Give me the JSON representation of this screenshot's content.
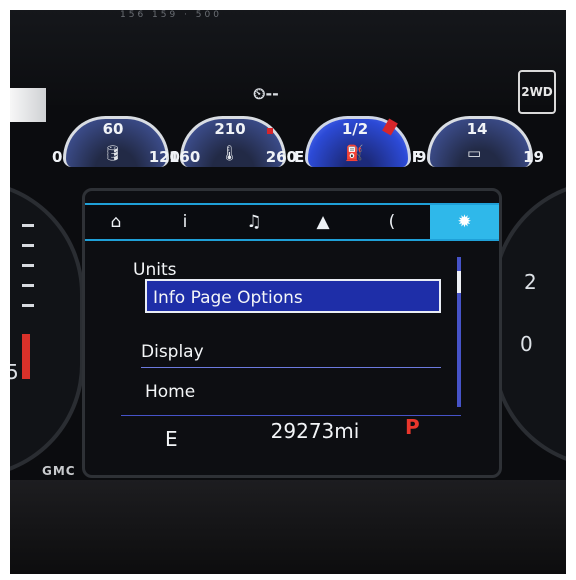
{
  "top_marks": "156  159 ·  500",
  "cruise_indicator": "⏲--",
  "drive_mode": "2WD",
  "gauges": [
    {
      "name": "oil-pressure",
      "lo": "0",
      "mid": "60",
      "hi": "120",
      "icon": "oil-can-icon",
      "glyph": "🛢"
    },
    {
      "name": "coolant-temp",
      "lo": "160",
      "mid": "210",
      "hi": "260",
      "icon": "thermometer-icon",
      "glyph": "🌡"
    },
    {
      "name": "fuel-level",
      "lo": "E",
      "mid": "1/2",
      "hi": "F",
      "icon": "fuel-pump-icon",
      "glyph": "⛽"
    },
    {
      "name": "battery-voltage",
      "lo": "9",
      "mid": "14",
      "hi": "19",
      "icon": "battery-icon",
      "glyph": "▭"
    }
  ],
  "tabs": [
    {
      "name": "home",
      "glyph": "⌂",
      "icon": "home-icon"
    },
    {
      "name": "info",
      "glyph": "i",
      "icon": "info-icon"
    },
    {
      "name": "audio",
      "glyph": "♫",
      "icon": "music-note-icon"
    },
    {
      "name": "navigation",
      "glyph": "▲",
      "icon": "navigation-arrow-icon"
    },
    {
      "name": "phone",
      "glyph": "(",
      "icon": "phone-icon"
    },
    {
      "name": "settings",
      "glyph": "✹",
      "icon": "gear-icon",
      "active": true
    }
  ],
  "menu": {
    "items": [
      "Units",
      "Info Page Options",
      "Display",
      "Home"
    ],
    "selected_index": 1
  },
  "status": {
    "fuel_letter": "E",
    "odometer": "29273mi",
    "gear": "P"
  },
  "badge": "GMC",
  "left_gauge_numeral": "5",
  "right_gauge_numerals": [
    "2",
    "0"
  ],
  "colors": {
    "accent_blue": "#2fb8ea",
    "selection_blue": "#1e2ea8",
    "gear_red": "#e9362c"
  }
}
